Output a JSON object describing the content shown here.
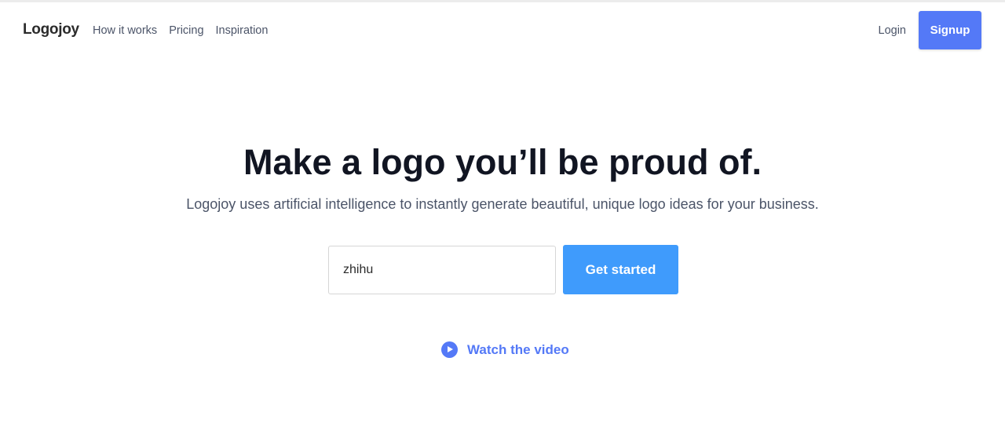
{
  "nav": {
    "logo": "Logojoy",
    "links": [
      "How it works",
      "Pricing",
      "Inspiration"
    ],
    "login": "Login",
    "signup": "Signup"
  },
  "hero": {
    "title": "Make a logo you’ll be proud of.",
    "subtitle": "Logojoy uses artificial intelligence to instantly generate beautiful, unique logo ideas for your business.",
    "input_value": "zhihu",
    "cta": "Get started",
    "video_link": "Watch the video",
    "video_icon": "play-circle-icon"
  },
  "colors": {
    "primary": "#5479f7",
    "cta": "#3f9bfc",
    "text": "#111522"
  }
}
